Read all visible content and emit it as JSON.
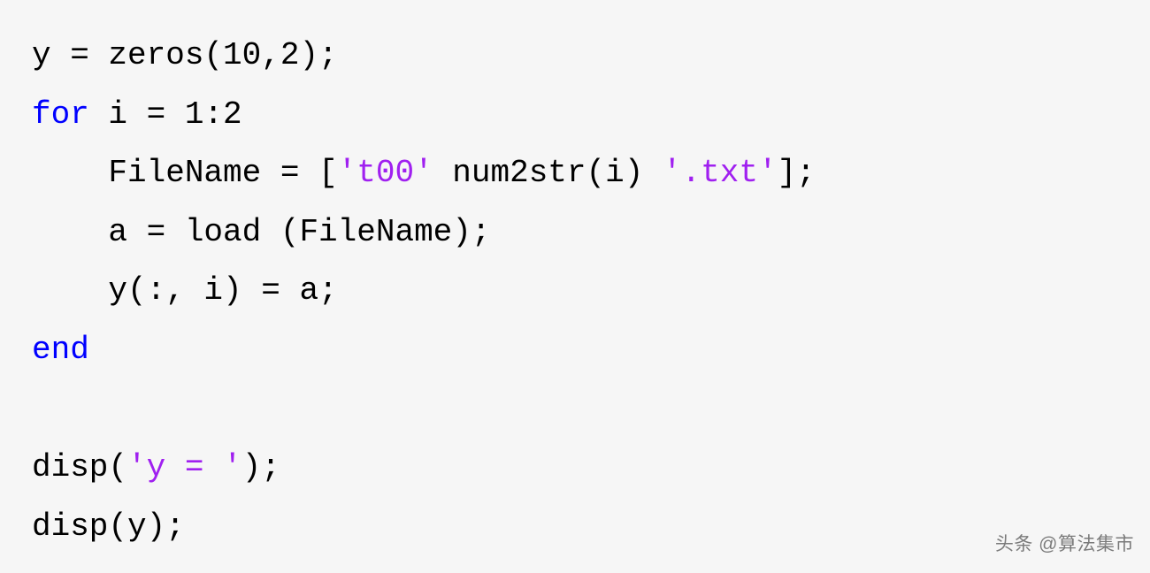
{
  "code": {
    "line1_a": "y = zeros(10,2);",
    "line2_kw": "for",
    "line2_b": " i = 1:2",
    "line3_a": "    FileName = [",
    "line3_s1": "'t00'",
    "line3_b": " num2str(i) ",
    "line3_s2": "'.txt'",
    "line3_c": "];",
    "line4_a": "    a = load (FileName);",
    "line5_a": "    y(:, i) = a;",
    "line6_kw": "end",
    "line7_blank": "",
    "line8_a": "disp(",
    "line8_s": "'y = '",
    "line8_b": ");",
    "line9_a": "disp(y);"
  },
  "watermark": "头条 @算法集市"
}
